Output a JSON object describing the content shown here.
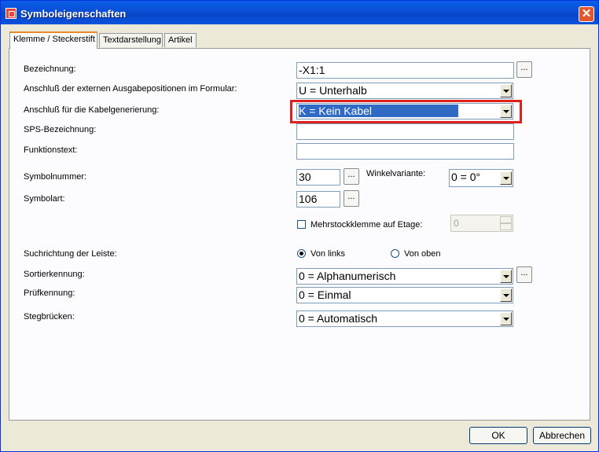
{
  "window": {
    "title": "Symboleigenschaften",
    "close": "✕"
  },
  "tabs": [
    "Klemme / Steckerstift",
    "Textdarstellung",
    "Artikel"
  ],
  "labels": {
    "bezeichnung": "Bezeichnung:",
    "anschluss_extern": "Anschluß der externen Ausgabepositionen im Formular:",
    "anschluss_kabel": "Anschluß für die Kabelgenerierung:",
    "sps": "SPS-Bezeichnung:",
    "funktionstext": "Funktionstext:",
    "symbolnummer": "Symbolnummer:",
    "winkelvariante": "Winkelvariante:",
    "symbolart": "Symbolart:",
    "mehrstock": "Mehrstockklemme auf Etage:",
    "suchrichtung": "Suchrichtung der Leiste:",
    "von_links": "Von links",
    "von_oben": "Von oben",
    "sortierkennung": "Sortierkennung:",
    "pruefkennung": "Prüfkennung:",
    "stegbruecken": "Stegbrücken:"
  },
  "values": {
    "bezeichnung": "-X1:1",
    "anschluss_extern": "U = Unterhalb",
    "anschluss_kabel": "K = Kein Kabel",
    "sps": "",
    "funktionstext": "",
    "symbolnummer": "30",
    "winkelvariante": "0 = 0°",
    "symbolart": "106",
    "mehrstock_etage": "0",
    "sortierkennung": "0 = Alphanumerisch",
    "pruefkennung": "0 = Einmal",
    "stegbruecken": "0 = Automatisch"
  },
  "states": {
    "mehrstock_checked": false,
    "suchrichtung": "Von links"
  },
  "browse": "...",
  "buttons": {
    "ok": "OK",
    "cancel": "Abbrechen"
  },
  "colors": {
    "title_bar": "#0a5ee8",
    "highlight": "#e0201d",
    "selection": "#316ac5"
  }
}
